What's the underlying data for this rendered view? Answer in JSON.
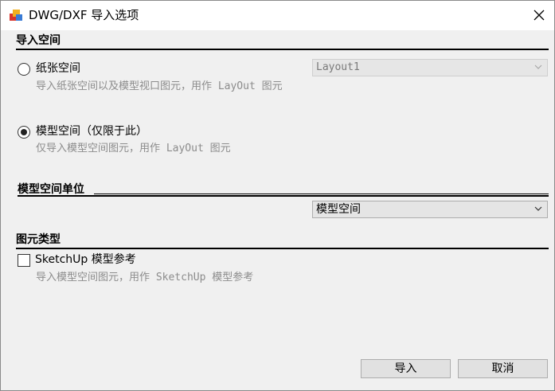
{
  "window": {
    "title": "DWG/DXF 导入选项"
  },
  "import_space": {
    "heading": "导入空间",
    "paper": {
      "label": "纸张空间",
      "description": "导入纸张空间以及模型视口图元，用作 LayOut 图元",
      "selected": false,
      "layout_select": {
        "value": "Layout1",
        "enabled": false
      }
    },
    "model": {
      "label": "模型空间（仅限于此）",
      "description": "仅导入模型空间图元，用作 LayOut 图元",
      "selected": true
    }
  },
  "units": {
    "heading": "模型空间单位",
    "select": {
      "value": "模型空间",
      "enabled": true
    }
  },
  "entity_type": {
    "heading": "图元类型",
    "sketchup": {
      "label": "SketchUp 模型参考",
      "description": "导入模型空间图元，用作 SketchUp 模型参考",
      "checked": false
    }
  },
  "buttons": {
    "import": "导入",
    "cancel": "取消"
  },
  "icons": {
    "app": "dwg-import-icon",
    "close": "close-icon",
    "dropdown": "chevron-down-icon"
  }
}
